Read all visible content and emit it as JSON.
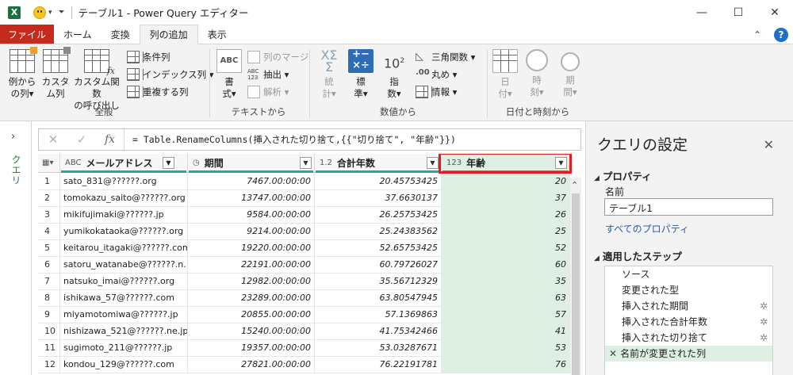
{
  "titlebar": {
    "app_icon": "X",
    "title": "テーブル1 - Power Query エディター",
    "minimize": "—",
    "maximize": "☐",
    "close": "✕"
  },
  "tabs": {
    "items": [
      "ファイル",
      "ホーム",
      "変換",
      "列の追加",
      "表示"
    ],
    "active": "列の追加",
    "collapse": "⌃",
    "help": "?"
  },
  "ribbon": {
    "general": {
      "label": "全般",
      "example_column_1": "例から",
      "example_column_2": "の列",
      "custom_column_1": "カスタ",
      "custom_column_2": "ム列",
      "invoke_function_1": "カスタム関数",
      "invoke_function_2": "の呼び出し",
      "conditional_column": "条件列",
      "index_column": "インデックス列",
      "duplicate_column": "重複する列"
    },
    "text": {
      "label": "テキストから",
      "format_1": "書",
      "format_2": "式",
      "merge_columns": "列のマージ",
      "extract_prefix": "ABC\n123",
      "extract": "抽出",
      "parse": "解析"
    },
    "number": {
      "label": "数値から",
      "statistics_1": "統",
      "statistics_2": "計",
      "standard_1": "標",
      "standard_2": "準",
      "scientific_1": "指",
      "scientific_2": "数",
      "trigonometry": "三角関数",
      "rounding": "丸め",
      "information": "情報"
    },
    "datetime": {
      "label": "日付と時刻から",
      "date_1": "日",
      "date_2": "付",
      "time_1": "時",
      "time_2": "刻",
      "duration_1": "期",
      "duration_2": "間"
    }
  },
  "leftnav": {
    "expand": "›",
    "label": "クエリ"
  },
  "formula_bar": {
    "cancel": "✕",
    "confirm": "✓",
    "fx": "fx",
    "formula": "= Table.RenameColumns(挿入された切り捨て,{{\"切り捨て\", \"年齢\"}})"
  },
  "grid": {
    "columns": [
      {
        "type": "ABC",
        "name": "メールアドレス"
      },
      {
        "type": "◷",
        "name": "期間"
      },
      {
        "type": "1.2",
        "name": "合計年数"
      },
      {
        "type": "123",
        "name": "年齢"
      }
    ],
    "rows": [
      {
        "n": "1",
        "email": "sato_831@??????.org",
        "duration": "7467.00:00:00",
        "years": "20.45753425",
        "age": "20"
      },
      {
        "n": "2",
        "email": "tomokazu_saito@??????.org",
        "duration": "13747.00:00:00",
        "years": "37.6630137",
        "age": "37"
      },
      {
        "n": "3",
        "email": "mikifujimaki@??????.jp",
        "duration": "9584.00:00:00",
        "years": "26.25753425",
        "age": "26"
      },
      {
        "n": "4",
        "email": "yumikokataoka@??????.org",
        "duration": "9214.00:00:00",
        "years": "25.24383562",
        "age": "25"
      },
      {
        "n": "5",
        "email": "keitarou_itagaki@??????.com",
        "duration": "19220.00:00:00",
        "years": "52.65753425",
        "age": "52"
      },
      {
        "n": "6",
        "email": "satoru_watanabe@??????.n...",
        "duration": "22191.00:00:00",
        "years": "60.79726027",
        "age": "60"
      },
      {
        "n": "7",
        "email": "natsuko_imai@??????.org",
        "duration": "12982.00:00:00",
        "years": "35.56712329",
        "age": "35"
      },
      {
        "n": "8",
        "email": "ishikawa_57@??????.com",
        "duration": "23289.00:00:00",
        "years": "63.80547945",
        "age": "63"
      },
      {
        "n": "9",
        "email": "miyamotomiwa@??????.jp",
        "duration": "20855.00:00:00",
        "years": "57.1369863",
        "age": "57"
      },
      {
        "n": "10",
        "email": "nishizawa_521@??????.ne.jp",
        "duration": "15240.00:00:00",
        "years": "41.75342466",
        "age": "41"
      },
      {
        "n": "11",
        "email": "sugimoto_211@??????.jp",
        "duration": "19357.00:00:00",
        "years": "53.03287671",
        "age": "53"
      },
      {
        "n": "12",
        "email": "kondou_129@??????.com",
        "duration": "27821.00:00:00",
        "years": "76.22191781",
        "age": "76"
      }
    ],
    "colors": {
      "selected_column": "#ddf0e3",
      "quality_bar": "#28a69a",
      "highlight_box": "#e02020"
    }
  },
  "query_settings": {
    "title": "クエリの設定",
    "close": "✕",
    "properties_header": "プロパティ",
    "name_label": "名前",
    "name_value": "テーブル1",
    "all_properties": "すべてのプロパティ",
    "steps_header": "適用したステップ",
    "steps": [
      {
        "label": "ソース",
        "gear": ""
      },
      {
        "label": "変更された型",
        "gear": ""
      },
      {
        "label": "挿入された期間",
        "gear": "✲"
      },
      {
        "label": "挿入された合計年数",
        "gear": "✲"
      },
      {
        "label": "挿入された切り捨て",
        "gear": "✲"
      },
      {
        "label": "名前が変更された列",
        "gear": ""
      }
    ]
  }
}
